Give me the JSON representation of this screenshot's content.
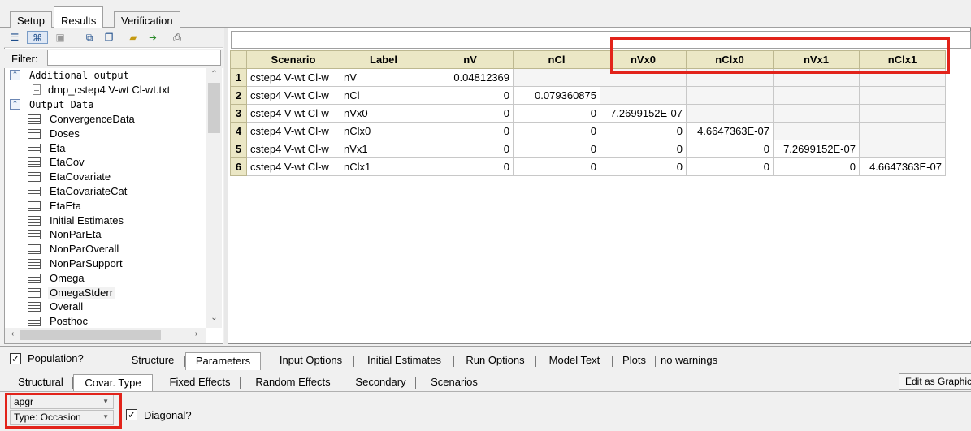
{
  "top_tabs": [
    "Setup",
    "Results",
    "Verification"
  ],
  "toolbar_icons": [
    "list-view-icon",
    "tree-view-icon",
    "image-view-icon",
    "copy-icon",
    "copy-all-icon",
    "open-folder-icon",
    "export-icon",
    "print-icon"
  ],
  "filter": {
    "label": "Filter:",
    "value": ""
  },
  "tree": {
    "additional_output": "Additional output",
    "file_item": "dmp_cstep4 V-wt Cl-wt.txt",
    "output_data": "Output Data",
    "items": [
      "ConvergenceData",
      "Doses",
      "Eta",
      "EtaCov",
      "EtaCovariate",
      "EtaCovariateCat",
      "EtaEta",
      "Initial Estimates",
      "NonParEta",
      "NonParOverall",
      "NonParSupport",
      "Omega",
      "OmegaStderr",
      "Overall",
      "Posthoc"
    ],
    "selected": "OmegaStderr"
  },
  "grid": {
    "columns": [
      "Scenario",
      "Label",
      "nV",
      "nCl",
      "nVx0",
      "nClx0",
      "nVx1",
      "nClx1"
    ],
    "rows": [
      [
        "1",
        "cstep4 V-wt Cl-w",
        "nV",
        "0.04812369",
        "",
        "",
        "",
        "",
        ""
      ],
      [
        "2",
        "cstep4 V-wt Cl-w",
        "nCl",
        "0",
        "0.079360875",
        "",
        "",
        "",
        ""
      ],
      [
        "3",
        "cstep4 V-wt Cl-w",
        "nVx0",
        "0",
        "0",
        "7.2699152E-07",
        "",
        "",
        ""
      ],
      [
        "4",
        "cstep4 V-wt Cl-w",
        "nClx0",
        "0",
        "0",
        "0",
        "4.6647363E-07",
        "",
        ""
      ],
      [
        "5",
        "cstep4 V-wt Cl-w",
        "nVx1",
        "0",
        "0",
        "0",
        "0",
        "7.2699152E-07",
        ""
      ],
      [
        "6",
        "cstep4 V-wt Cl-w",
        "nClx1",
        "0",
        "0",
        "0",
        "0",
        "0",
        "4.6647363E-07"
      ]
    ]
  },
  "bottom": {
    "population_label": "Population?",
    "population_checked": true,
    "model_tabs": [
      "Structure",
      "Parameters",
      "Input Options",
      "Initial Estimates",
      "Run Options",
      "Model Text",
      "Plots",
      "no warnings"
    ],
    "model_tab_active": "Parameters",
    "param_tabs": [
      "Structural",
      "Covar. Type",
      "Fixed Effects",
      "Random Effects",
      "Secondary",
      "Scenarios"
    ],
    "param_tab_active": "Covar. Type",
    "edit_button": "Edit as Graphic",
    "covariate_select": "apgr",
    "type_select": "Type: Occasion",
    "diagonal_label": "Diagonal?",
    "diagonal_checked": true
  },
  "colors": {
    "highlight": "#e2231a",
    "grid_header": "#ebe7c5"
  }
}
